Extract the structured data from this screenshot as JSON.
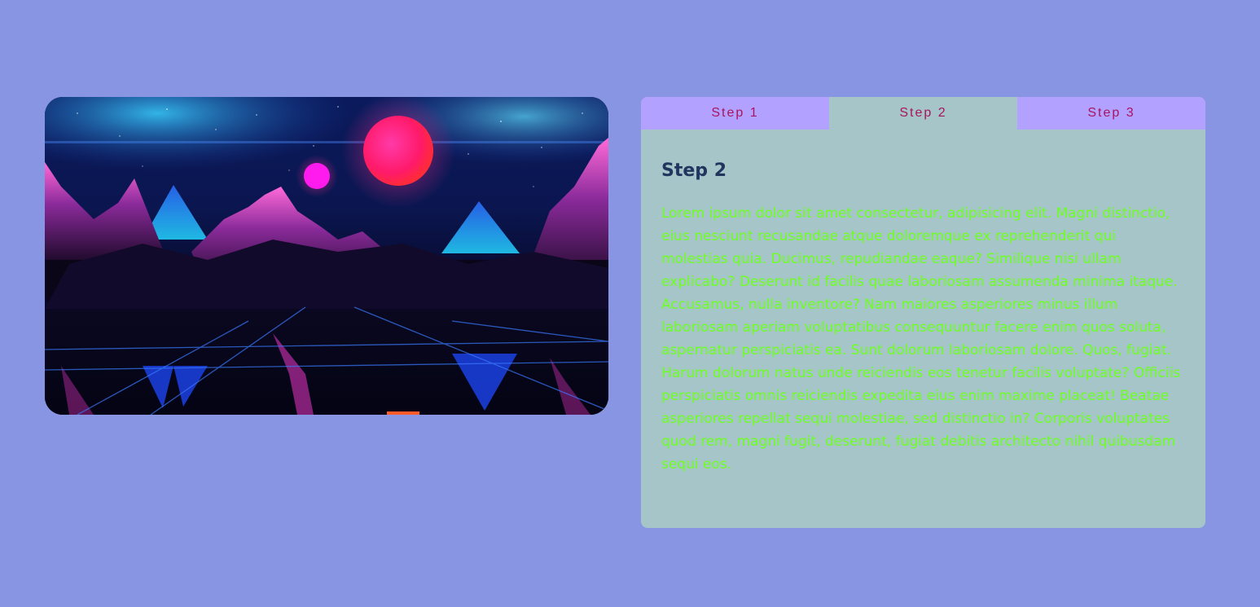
{
  "colors": {
    "page_background": "#8895e2",
    "card_background": "#a6c5c9",
    "tab_background": "#b3a1ff",
    "tab_text": "#a8145f",
    "heading": "#21355e",
    "body_text": "#6cff1f"
  },
  "image": {
    "description_icon": "synthwave-landscape-image"
  },
  "tabs": [
    {
      "label": "Step 1",
      "active": false
    },
    {
      "label": "Step 2",
      "active": true
    },
    {
      "label": "Step 3",
      "active": false
    }
  ],
  "panel": {
    "title": "Step 2",
    "body": "Lorem ipsum dolor sit amet consectetur, adipisicing elit. Magni distinctio, eius nesciunt recusandae atque doloremque ex reprehenderit qui molestias quia. Ducimus, repudiandae eaque? Similique nisi ullam explicabo? Deserunt id facilis quae laboriosam assumenda minima itaque. Accusamus, nulla inventore? Nam maiores asperiores minus illum laboriosam aperiam voluptatibus consequuntur facere enim quos soluta, aspernatur perspiciatis ea. Sunt dolorum laboriosam dolore. Quos, fugiat. Harum dolorum natus unde reiciendis eos tenetur facilis voluptate? Officiis perspiciatis omnis reiciendis expedita eius enim maxime placeat! Beatae asperiores repellat sequi molestiae, sed distinctio in? Corporis voluptates quod rem, magni fugit, deserunt, fugiat debitis architecto nihil quibusdam sequi eos."
  }
}
